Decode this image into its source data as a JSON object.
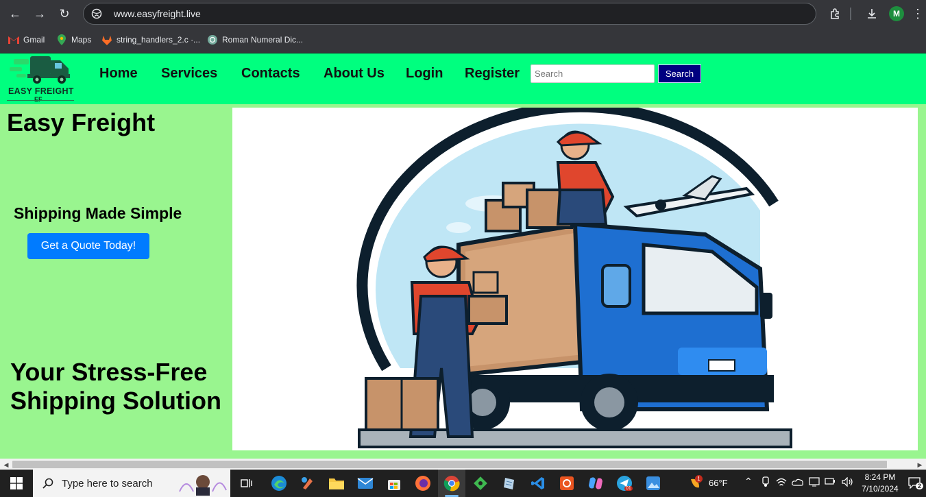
{
  "browser": {
    "url": "www.easyfreight.live",
    "avatar_letter": "M",
    "bookmarks": [
      {
        "label": "Gmail",
        "icon": "gmail-icon"
      },
      {
        "label": "Maps",
        "icon": "maps-icon"
      },
      {
        "label": "string_handlers_2.c ·...",
        "icon": "gitlab-icon"
      },
      {
        "label": "Roman Numeral Dic...",
        "icon": "chatgpt-icon"
      }
    ]
  },
  "site": {
    "logo_text": "EASY FREIGHT",
    "logo_sub": "EF",
    "nav": [
      "Home",
      "Services",
      "Contacts",
      "About Us",
      "Login",
      "Register"
    ],
    "search_placeholder": "Search",
    "search_button": "Search",
    "brand": "Easy Freight",
    "tagline": "Shipping Made Simple",
    "cta": "Get a Quote Today!",
    "slogan_line1": "Your Stress-Free",
    "slogan_line2": "Shipping Solution",
    "colors": {
      "header": "#00ff7f",
      "body": "#99f58f",
      "cta": "#007bff",
      "search_btn": "#000080"
    }
  },
  "taskbar": {
    "search_placeholder": "Type here to search",
    "weather": "66°F",
    "weather_badge": "1",
    "time": "8:24 PM",
    "date": "7/10/2024",
    "notification_count": "2",
    "telegram_badge": "01"
  }
}
